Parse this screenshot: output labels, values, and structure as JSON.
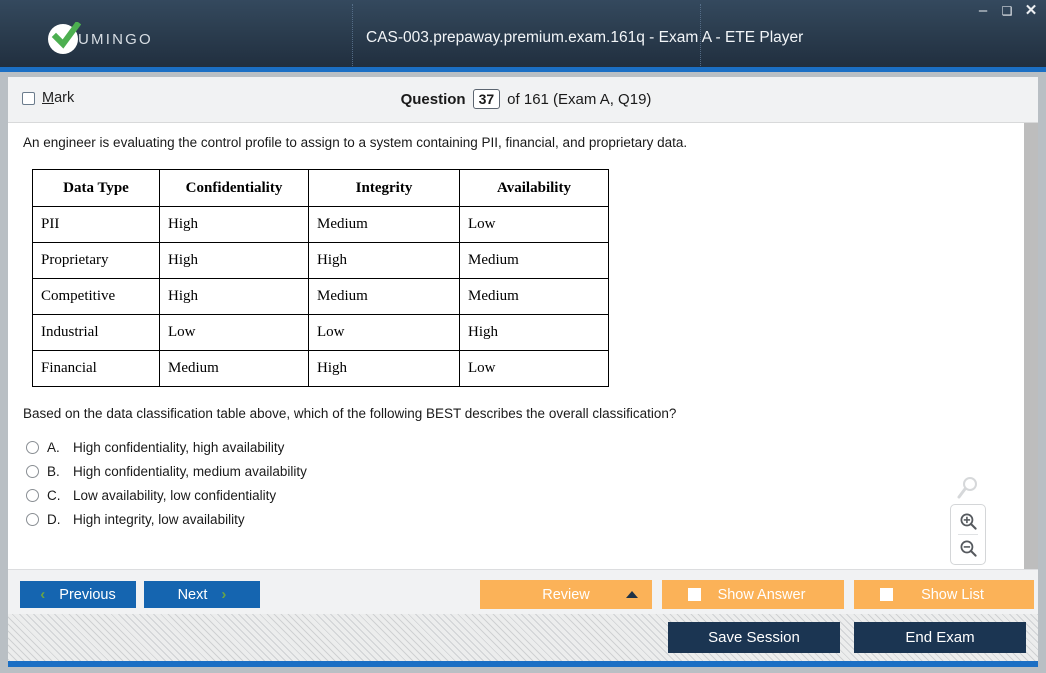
{
  "window": {
    "title": "CAS-003.prepaway.premium.exam.161q - Exam A - ETE Player",
    "logo_text": "UMINGO",
    "minimize": "–",
    "maximize": "❑",
    "close": "✕"
  },
  "question_header": {
    "mark_label_prefix": "",
    "mark_label": "Mark",
    "mark_accel": "M",
    "mark_rest": "ark",
    "question_word": "Question",
    "question_number": "37",
    "rest": "of 161 (Exam A, Q19)"
  },
  "question": {
    "stem": "An engineer is evaluating the control profile to assign to a system containing PII, financial, and proprietary data.",
    "prompt": "Based on the data classification table above, which of the following BEST describes the overall classification?",
    "table": {
      "headers": [
        "Data Type",
        "Confidentiality",
        "Integrity",
        "Availability"
      ],
      "rows": [
        [
          "PII",
          "High",
          "Medium",
          "Low"
        ],
        [
          "Proprietary",
          "High",
          "High",
          "Medium"
        ],
        [
          "Competitive",
          "High",
          "Medium",
          "Medium"
        ],
        [
          "Industrial",
          "Low",
          "Low",
          "High"
        ],
        [
          "Financial",
          "Medium",
          "High",
          "Low"
        ]
      ]
    },
    "options": [
      {
        "letter": "A.",
        "text": "High confidentiality, high availability"
      },
      {
        "letter": "B.",
        "text": "High confidentiality, medium availability"
      },
      {
        "letter": "C.",
        "text": "Low availability, low confidentiality"
      },
      {
        "letter": "D.",
        "text": "High integrity, low availability"
      }
    ]
  },
  "navbar": {
    "previous": "Previous",
    "next": "Next",
    "prev_chevron": "‹",
    "next_chevron": "›",
    "review": "Review",
    "show_answer": "Show Answer",
    "show_list": "Show List"
  },
  "footer": {
    "save_session": "Save Session",
    "end_exam": "End Exam"
  },
  "colors": {
    "header_dark": "#2c3e50",
    "accent_blue": "#1b6fc4",
    "button_blue": "#1565b0",
    "button_orange": "#fbb258",
    "button_dark": "#1b3552",
    "logo_green": "#4caf50"
  }
}
